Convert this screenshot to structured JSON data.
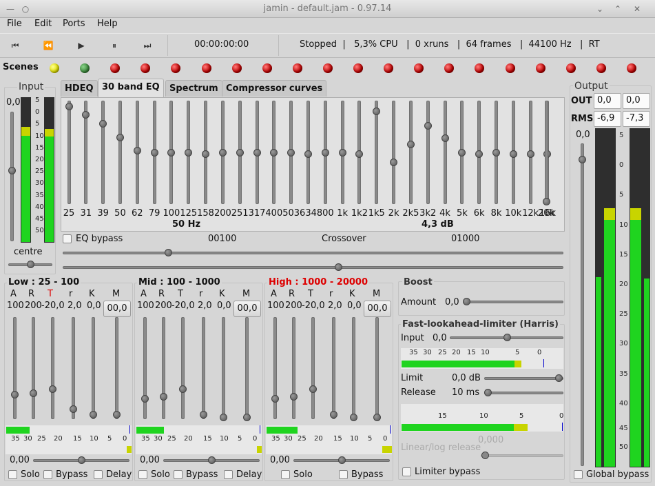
{
  "window": {
    "title": "jamin - default.jam - 0.97.14"
  },
  "menu": [
    "File",
    "Edit",
    "Ports",
    "Help"
  ],
  "toolbar": {
    "time": "00:00:00:00",
    "status": "Stopped  |   5,3% CPU   |  0 xruns   |  64 frames   |  44100 Hz   |  RT"
  },
  "scenes": {
    "label": "Scenes",
    "leds": [
      "yellow",
      "green",
      "red",
      "red",
      "red",
      "red",
      "red",
      "red",
      "red",
      "red",
      "red",
      "red",
      "red",
      "red",
      "red",
      "red",
      "red",
      "red",
      "red",
      "red"
    ]
  },
  "input": {
    "title": "Input",
    "value": "0,0",
    "balance": "centre",
    "scale": [
      "5",
      "0",
      "5",
      "10",
      "15",
      "20",
      "25",
      "30",
      "35",
      "40",
      "45",
      "50"
    ],
    "gain_level": 0.55,
    "balance_level": 0.5
  },
  "tabs": [
    "HDEQ",
    "30 band EQ",
    "Spectrum",
    "Compressor curves"
  ],
  "eq": {
    "bands": [
      "25",
      "31",
      "39",
      "50",
      "62",
      "79",
      "100",
      "125",
      "158",
      "200",
      "251",
      "317",
      "400",
      "503",
      "634",
      "800",
      "1k",
      "1k2",
      "1k5",
      "2k",
      "2k5",
      "3k2",
      "4k",
      "5k",
      "6k",
      "8k",
      "10k",
      "12k",
      "16k",
      "20k"
    ],
    "levels": [
      0.95,
      0.87,
      0.78,
      0.65,
      0.52,
      0.5,
      0.5,
      0.5,
      0.49,
      0.5,
      0.5,
      0.5,
      0.5,
      0.5,
      0.49,
      0.5,
      0.5,
      0.49,
      0.9,
      0.41,
      0.58,
      0.76,
      0.64,
      0.5,
      0.49,
      0.5,
      0.49,
      0.49,
      0.49,
      0.03
    ],
    "freq_readout": "50 Hz",
    "gain_readout": "4,3 dB",
    "bypass_label": "EQ bypass",
    "crossover_low": "00100",
    "crossover_label": "Crossover",
    "crossover_high": "01000",
    "crossover1_level": 0.21,
    "crossover2_level": 0.55
  },
  "bands": [
    {
      "title": "Low : 25 - 100",
      "color": "#111111",
      "labels": [
        "A",
        "R",
        "T",
        "r",
        "K",
        "M"
      ],
      "values": [
        "100",
        "200",
        "-20,0",
        "2,0",
        "0,0"
      ],
      "makeup": "00,0",
      "t_color": "#dd0000",
      "slider_levels": [
        0.24,
        0.26,
        0.3,
        0.1,
        0.05,
        0.05
      ],
      "meter_labels": [
        "35",
        "30",
        "25",
        "20",
        "15",
        "10",
        "5",
        "0"
      ],
      "meter_level": 0.41,
      "bottom_value": "0,00",
      "bottom_level": 0.5,
      "solo": "Solo",
      "bypass": "Bypass",
      "delay": "Delay"
    },
    {
      "title": "Mid : 100 - 1000",
      "color": "#111111",
      "labels": [
        "A",
        "R",
        "T",
        "r",
        "K",
        "M"
      ],
      "values": [
        "100",
        "200",
        "-20,0",
        "2,0",
        "0,0"
      ],
      "makeup": "00,0",
      "t_color": "#111111",
      "slider_levels": [
        0.2,
        0.22,
        0.3,
        0.05,
        0.02,
        0.02
      ],
      "meter_labels": [
        "35",
        "30",
        "25",
        "20",
        "15",
        "10",
        "5",
        "0"
      ],
      "meter_level": 0.48,
      "bottom_value": "0,00",
      "bottom_level": 0.5,
      "solo": "Solo",
      "bypass": "Bypass",
      "delay": "Delay"
    },
    {
      "title": "High : 1000 - 20000",
      "color": "#dd0000",
      "labels": [
        "A",
        "R",
        "T",
        "r",
        "K",
        "M"
      ],
      "values": [
        "100",
        "200",
        "-20,0",
        "2,0",
        "0,0"
      ],
      "makeup": "00,0",
      "t_color": "#111111",
      "slider_levels": [
        0.2,
        0.22,
        0.3,
        0.05,
        0.02,
        0.02
      ],
      "meter_labels": [
        "35",
        "30",
        "25",
        "20",
        "15",
        "10",
        "5",
        "0"
      ],
      "meter_level": 0.55,
      "bottom_value": "0,00",
      "bottom_level": 0.5,
      "solo": "Solo",
      "bypass": "Bypass"
    }
  ],
  "boost": {
    "title": "Boost",
    "amount_label": "Amount",
    "amount_value": "0,0",
    "amount_level": 0.0
  },
  "limiter": {
    "title": "Fast-lookahead-limiter (Harris)",
    "input_label": "Input",
    "input_value": "0,0",
    "input_level": 0.5,
    "meter1_labels": [
      "35",
      "30",
      "25",
      "20",
      "15",
      "10",
      "5",
      "0"
    ],
    "limit_label": "Limit",
    "limit_value": "0,0 dB",
    "limit_level": 1.0,
    "release_label": "Release",
    "release_value": "10 ms",
    "release_level": 0.0,
    "meter2_labels": [
      "15",
      "10",
      "5",
      "0"
    ],
    "log_value": "0,000",
    "log_label": "Linear/log release",
    "bypass_label": "Limiter bypass"
  },
  "output": {
    "title": "Output",
    "out_label": "OUT",
    "rms_label": "RMS",
    "out_l": "0,0",
    "out_r": "0,0",
    "rms_l": "-6,9",
    "rms_r": "-7,3",
    "gain_value": "0,0",
    "gain_level": 0.95,
    "scale": [
      "5",
      "0",
      "5",
      "10",
      "15",
      "20",
      "25",
      "30",
      "35",
      "40",
      "45",
      "50"
    ],
    "global_bypass": "Global bypass"
  }
}
